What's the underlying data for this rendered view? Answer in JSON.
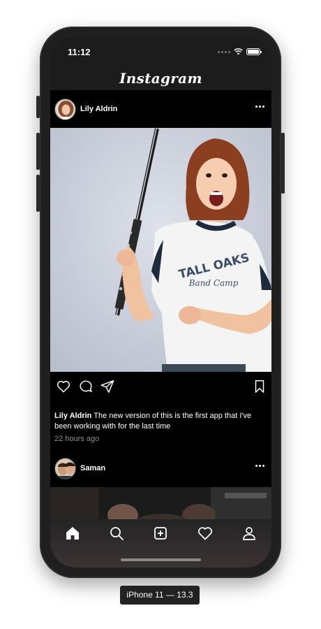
{
  "status_bar": {
    "time": "11:12"
  },
  "nav": {
    "title": "Instagram"
  },
  "posts": [
    {
      "username": "Lily Aldrin",
      "caption": "The new version of this is the first app that I've been working with for the last time",
      "timestamp": "22 hours ago"
    },
    {
      "username": "Saman"
    }
  ],
  "image": {
    "shirt_text_1": "TALL OAKS",
    "shirt_text_2": "Band Camp"
  },
  "device_label": "iPhone 11 — 13.3",
  "colors": {
    "background": "#000000",
    "bar": "#1c1c1c",
    "text": "#ffffff",
    "muted": "#8e8e8e"
  },
  "icons": {
    "actions": [
      "heart-icon",
      "comment-icon",
      "send-icon",
      "bookmark-icon"
    ],
    "tabs": [
      "home-icon",
      "search-icon",
      "add-post-icon",
      "activity-heart-icon",
      "profile-icon"
    ]
  }
}
